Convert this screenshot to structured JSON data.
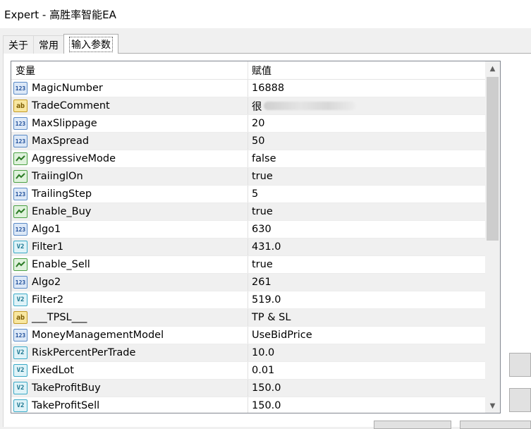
{
  "window": {
    "title": "Expert - 高胜率智能EA"
  },
  "tabs": [
    {
      "label": "关于"
    },
    {
      "label": "常用"
    },
    {
      "label": "输入参数"
    }
  ],
  "grid": {
    "header": {
      "variable": "变量",
      "value": "赋值"
    },
    "rows": [
      {
        "type": "int",
        "icon": "123",
        "name": "MagicNumber",
        "value": "16888"
      },
      {
        "type": "str",
        "icon": "ab",
        "name": "TradeComment",
        "value": "很"
      },
      {
        "type": "int",
        "icon": "123",
        "name": "MaxSlippage",
        "value": "20"
      },
      {
        "type": "int",
        "icon": "123",
        "name": "MaxSpread",
        "value": "50"
      },
      {
        "type": "bool",
        "icon": "bool",
        "name": "AggressiveMode",
        "value": "false"
      },
      {
        "type": "bool",
        "icon": "bool",
        "name": "TraiinglOn",
        "value": "true"
      },
      {
        "type": "int",
        "icon": "123",
        "name": "TrailingStep",
        "value": "5"
      },
      {
        "type": "bool",
        "icon": "bool",
        "name": "Enable_Buy",
        "value": "true"
      },
      {
        "type": "int",
        "icon": "123",
        "name": "Algo1",
        "value": "630"
      },
      {
        "type": "dbl",
        "icon": "V2",
        "name": "Filter1",
        "value": "431.0"
      },
      {
        "type": "bool",
        "icon": "bool",
        "name": "Enable_Sell",
        "value": "true"
      },
      {
        "type": "int",
        "icon": "123",
        "name": "Algo2",
        "value": "261"
      },
      {
        "type": "dbl",
        "icon": "V2",
        "name": "Filter2",
        "value": "519.0"
      },
      {
        "type": "str",
        "icon": "ab",
        "name": "___TPSL___",
        "value": "TP & SL"
      },
      {
        "type": "int",
        "icon": "123",
        "name": "MoneyManagementModel",
        "value": "UseBidPrice"
      },
      {
        "type": "dbl",
        "icon": "V2",
        "name": "RiskPercentPerTrade",
        "value": "10.0"
      },
      {
        "type": "dbl",
        "icon": "V2",
        "name": "FixedLot",
        "value": "0.01"
      },
      {
        "type": "dbl",
        "icon": "V2",
        "name": "TakeProfitBuy",
        "value": "150.0"
      },
      {
        "type": "dbl",
        "icon": "V2",
        "name": "TakeProfitSell",
        "value": "150.0"
      }
    ]
  },
  "scroll": {
    "up_glyph": "▲",
    "down_glyph": "▼"
  }
}
